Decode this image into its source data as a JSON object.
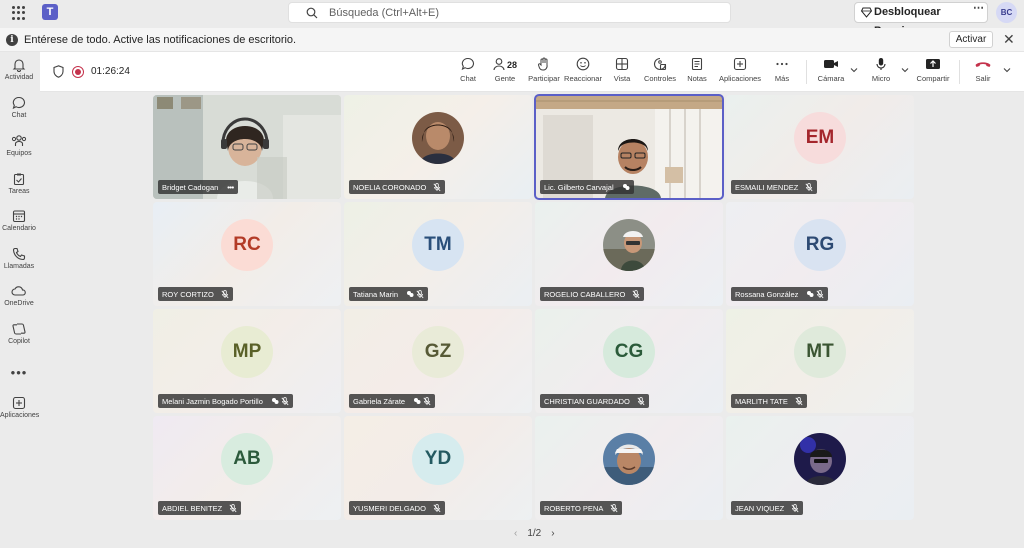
{
  "titlebar": {
    "app_icon": "teams-logo",
    "search_placeholder": "Búsqueda (Ctrl+Alt+E)",
    "premium_label": "Desbloquear Premium",
    "user_initials": "BC"
  },
  "notification": {
    "message": "Entérese de todo. Active las notificaciones de escritorio.",
    "action_label": "Activar"
  },
  "rail": {
    "items": [
      {
        "label": "Actividad",
        "icon": "bell-icon"
      },
      {
        "label": "Chat",
        "icon": "chat-icon"
      },
      {
        "label": "Equipos",
        "icon": "teams-icon"
      },
      {
        "label": "Tareas",
        "icon": "tasks-icon"
      },
      {
        "label": "Calendario",
        "icon": "calendar-icon"
      },
      {
        "label": "Llamadas",
        "icon": "phone-icon"
      },
      {
        "label": "OneDrive",
        "icon": "cloud-icon"
      },
      {
        "label": "Copilot",
        "icon": "copilot-icon"
      },
      {
        "label": "Aplicaciones",
        "icon": "add-apps-icon"
      }
    ]
  },
  "toolbar": {
    "timer": "01:26:24",
    "people_count": "28",
    "buttons": [
      {
        "label": "Chat",
        "icon": "chat-icon"
      },
      {
        "label": "Gente",
        "icon": "people-icon"
      },
      {
        "label": "Participar",
        "icon": "raise-hand-icon"
      },
      {
        "label": "Reaccionar",
        "icon": "emoji-icon"
      },
      {
        "label": "Vista",
        "icon": "view-grid-icon"
      },
      {
        "label": "Controles",
        "icon": "controls-icon"
      },
      {
        "label": "Notas",
        "icon": "notes-icon"
      },
      {
        "label": "Aplicaciones",
        "icon": "add-apps-icon"
      },
      {
        "label": "Más",
        "icon": "more-icon"
      },
      {
        "label": "Cámara",
        "icon": "camera-icon"
      },
      {
        "label": "Micro",
        "icon": "mic-icon"
      },
      {
        "label": "Compartir",
        "icon": "share-icon"
      },
      {
        "label": "Salir",
        "icon": "hangup-icon"
      }
    ]
  },
  "participants": [
    {
      "name": "Bridget Cadogan",
      "type": "video",
      "more": "•••"
    },
    {
      "name": "NOELIA CORONADO",
      "type": "photo",
      "muted": true
    },
    {
      "name": "Lic. Gilberto Carvajal",
      "type": "video",
      "active": true,
      "hand": true
    },
    {
      "name": "ESMAILI MENDEZ",
      "initials": "EM",
      "type": "initials",
      "muted": true
    },
    {
      "name": "ROY CORTIZO",
      "initials": "RC",
      "type": "initials",
      "muted": true
    },
    {
      "name": "Tatiana Marin",
      "initials": "TM",
      "type": "initials",
      "hand": true,
      "muted": true
    },
    {
      "name": "ROGELIO CABALLERO",
      "type": "photo",
      "muted": true
    },
    {
      "name": "Rossana González",
      "initials": "RG",
      "type": "initials",
      "hand": true,
      "muted": true
    },
    {
      "name": "Melani Jazmin Bogado Portillo",
      "initials": "MP",
      "type": "initials",
      "hand": true,
      "muted": true
    },
    {
      "name": "Gabriela Zárate",
      "initials": "GZ",
      "type": "initials",
      "hand": true,
      "muted": true
    },
    {
      "name": "CHRISTIAN GUARDADO",
      "initials": "CG",
      "type": "initials",
      "muted": true
    },
    {
      "name": "MARLITH TATE",
      "initials": "MT",
      "type": "initials",
      "muted": true
    },
    {
      "name": "ABDIEL BENITEZ",
      "initials": "AB",
      "type": "initials",
      "muted": true
    },
    {
      "name": "YUSMERI DELGADO",
      "initials": "YD",
      "type": "initials",
      "muted": true
    },
    {
      "name": "ROBERTO PENA",
      "type": "photo",
      "muted": true
    },
    {
      "name": "JEAN VIQUEZ",
      "type": "photo",
      "muted": true
    }
  ],
  "pagination": {
    "label": "1/2"
  },
  "colors": {
    "accent": "#5b5fc7",
    "hangup": "#c4314b"
  }
}
